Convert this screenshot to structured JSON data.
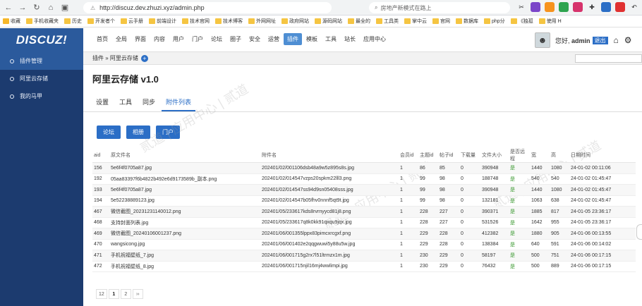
{
  "browser": {
    "url": "http://discuz.dev.zhuzi.xyz/admin.php",
    "search_placeholder": "房地产新模式在路上",
    "bookmarks": [
      "收藏",
      "手机收藏夹",
      "历史",
      "开发者个",
      "云手册",
      "前端设计",
      "技术官网",
      "技术博客",
      "外网网址",
      "政府网站",
      "源码网站",
      "最全的",
      "工具类",
      "掌中云",
      "官网",
      "数据库",
      "php分",
      "《独孤",
      "使用 H"
    ]
  },
  "header": {
    "logo": "DISCUZ!",
    "nav": [
      "首页",
      "全局",
      "界面",
      "内容",
      "用户",
      "门户",
      "论坛",
      "圈子",
      "安全",
      "运营",
      "插件",
      "模板",
      "工具",
      "站长",
      "应用中心"
    ],
    "active_nav": "插件",
    "greeting_prefix": "您好,",
    "username": "admin",
    "logout": "退出"
  },
  "sidebar": {
    "items": [
      {
        "label": "插件管理",
        "active": true
      },
      {
        "label": "阿里云存储",
        "active": false
      },
      {
        "label": "我的马甲",
        "active": false
      }
    ]
  },
  "breadcrumb": {
    "text": "插件 » 阿里云存储"
  },
  "page": {
    "title": "阿里云存储 v1.0"
  },
  "tabs": [
    {
      "label": "设置",
      "active": false
    },
    {
      "label": "工具",
      "active": false
    },
    {
      "label": "同步",
      "active": false
    },
    {
      "label": "附件列表",
      "active": true
    }
  ],
  "buttons": [
    "论坛",
    "相册",
    "门户"
  ],
  "table": {
    "headers": [
      "aid",
      "原文件名",
      "附件名",
      "会员id",
      "主题id",
      "帖子id",
      "下载量",
      "文件大小",
      "是否远程",
      "宽",
      "高",
      "日期时间"
    ],
    "rows": [
      [
        "156",
        "5e6f4f0705a87.jpg",
        "202401/02/001106dsb48a9w5z895s8s.jpg",
        "1",
        "86",
        "85",
        "0",
        "390948",
        "是",
        "1440",
        "1080",
        "24-01-02 00:11:06"
      ],
      [
        "192",
        "05aa83397f6b4822b492e6d9173589b_副本.png",
        "202401/02/014547vzps20spkm22lll3.png",
        "1",
        "99",
        "98",
        "0",
        "188748",
        "是",
        "540",
        "540",
        "24-01-02 01:45:47"
      ],
      [
        "193",
        "5e6f4f0705a87.jpg",
        "202401/02/014547ss94d9sn05408sss.jpg",
        "1",
        "99",
        "98",
        "0",
        "390948",
        "是",
        "1440",
        "1080",
        "24-01-02 01:45:47"
      ],
      [
        "194",
        "5e52238889123.jpg",
        "202401/02/014547b05fhv0nnnf5qt9t.jpg",
        "1",
        "99",
        "98",
        "0",
        "132181",
        "是",
        "1063",
        "638",
        "24-01-02 01:45:47"
      ],
      [
        "467",
        "微信截图_20231231140012.png",
        "202401/05/233617kds8rvrnyycd81j8.png",
        "1",
        "228",
        "227",
        "0",
        "390371",
        "是",
        "1885",
        "817",
        "24-01-05 23:36:17"
      ],
      [
        "468",
        "支持封面列表.jpg",
        "202401/05/233617q8k0kk91qxqu9jqx.jpg",
        "1",
        "228",
        "227",
        "0",
        "531526",
        "是",
        "1642",
        "955",
        "24-01-05 23:36:17"
      ],
      [
        "469",
        "微信截图_20240106001237.png",
        "202401/06/001355lppx83pimcxrcgxf.png",
        "1",
        "229",
        "228",
        "0",
        "412382",
        "是",
        "1880",
        "905",
        "24-01-06 00:13:55"
      ],
      [
        "470",
        "wangsicong.jpg",
        "202401/06/001402e2qqgwuwi5y88u5w.jpg",
        "1",
        "229",
        "228",
        "0",
        "138384",
        "是",
        "640",
        "591",
        "24-01-06 00:14:02"
      ],
      [
        "471",
        "手机祝福壁纸_7.jpg",
        "202401/06/001715g2rx7l51ltrmzx1m.jpg",
        "1",
        "230",
        "229",
        "0",
        "58197",
        "是",
        "500",
        "751",
        "24-01-06 00:17:15"
      ],
      [
        "472",
        "手机祝福壁纸_8.jpg",
        "202401/06/001715njil16mj4wwlimpi.jpg",
        "1",
        "230",
        "229",
        "0",
        "76432",
        "是",
        "500",
        "889",
        "24-01-06 00:17:15"
      ]
    ]
  },
  "pager": [
    "12",
    "1",
    "2",
    "››"
  ],
  "colors": {
    "sidebar": "#1c3b6f",
    "logo": "#2b5a9c",
    "accent": "#2b6ec6",
    "yes": "#3c9a32"
  }
}
